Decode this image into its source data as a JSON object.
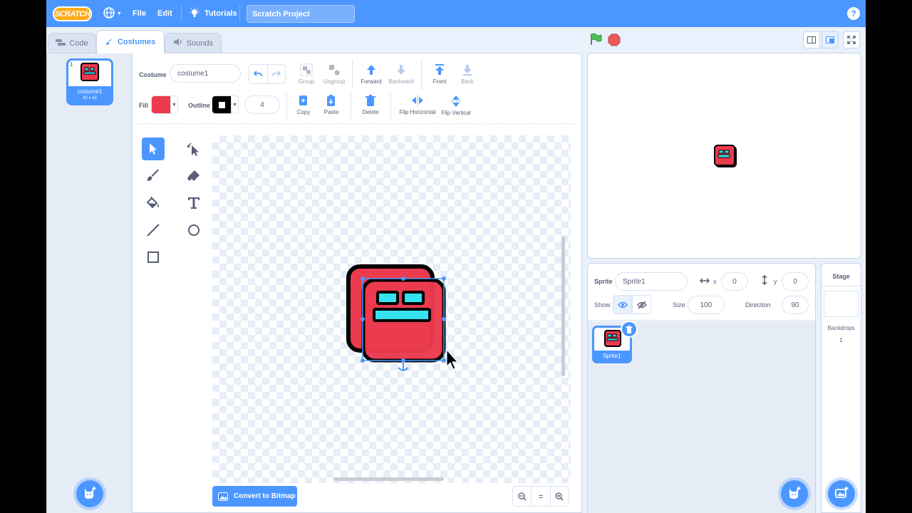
{
  "menubar": {
    "logo": "SCRATCH",
    "file": "File",
    "edit": "Edit",
    "tutorials": "Tutorials",
    "project_title": "Scratch Project",
    "help": "?"
  },
  "tabs": {
    "code": "Code",
    "costumes": "Costumes",
    "sounds": "Sounds"
  },
  "costume_list": {
    "items": [
      {
        "number": "1",
        "name": "costume1",
        "size": "42 x 42"
      }
    ]
  },
  "paint_editor": {
    "costume_label": "Costume",
    "costume_name": "costume1",
    "group": "Group",
    "ungroup": "Ungroup",
    "forward": "Forward",
    "backward": "Backward",
    "front": "Front",
    "back": "Back",
    "copy": "Copy",
    "paste": "Paste",
    "delete": "Delete",
    "flip_horizontal": "Flip Horizontal",
    "flip_vertical": "Flip Vertical",
    "fill_label": "Fill",
    "fill_color": "#ec3a4e",
    "outline_label": "Outline",
    "outline_color": "#000000",
    "outline_width": "4",
    "convert_button": "Convert to Bitmap",
    "zoom_reset": "="
  },
  "sprite_info": {
    "sprite_label": "Sprite",
    "sprite_name": "Sprite1",
    "x_label": "x",
    "x_value": "0",
    "y_label": "y",
    "y_value": "0",
    "show_label": "Show",
    "size_label": "Size",
    "size_value": "100",
    "direction_label": "Direction",
    "direction_value": "90"
  },
  "sprites": [
    {
      "name": "Sprite1"
    }
  ],
  "stage_pane": {
    "title": "Stage",
    "backdrops_label": "Backdrops",
    "backdrops_count": "1"
  },
  "colors": {
    "accent": "#4c97ff",
    "sprite_red": "#ec3a4e",
    "sprite_cyan": "#35e3f0"
  }
}
